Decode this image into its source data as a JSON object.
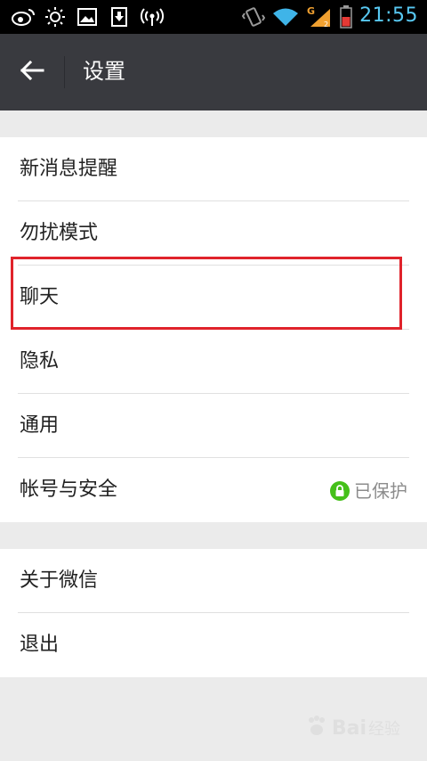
{
  "status_bar": {
    "time": "21:55",
    "network_type": "G",
    "sim_slot": "1",
    "icons": [
      "weibo-icon",
      "brightness-icon",
      "image-icon",
      "download-icon",
      "hotspot-icon",
      "vibrate-icon",
      "wifi-icon",
      "signal-icon",
      "battery-icon"
    ],
    "time_color": "#58c9f3",
    "battery_color": "#e53935"
  },
  "nav": {
    "title": "设置",
    "back_icon": "arrow-left-icon"
  },
  "groups": [
    {
      "items": [
        {
          "label": "新消息提醒"
        },
        {
          "label": "勿扰模式"
        },
        {
          "label": "聊天",
          "highlighted": true
        },
        {
          "label": "隐私"
        },
        {
          "label": "通用"
        },
        {
          "label": "帐号与安全",
          "status": "已保护",
          "status_icon": "lock-icon",
          "status_color": "#45c01a"
        }
      ]
    },
    {
      "items": [
        {
          "label": "关于微信"
        },
        {
          "label": "退出"
        }
      ]
    }
  ],
  "highlight_color": "#e0232b",
  "watermark": {
    "text": "Bai",
    "sub": "经验"
  }
}
